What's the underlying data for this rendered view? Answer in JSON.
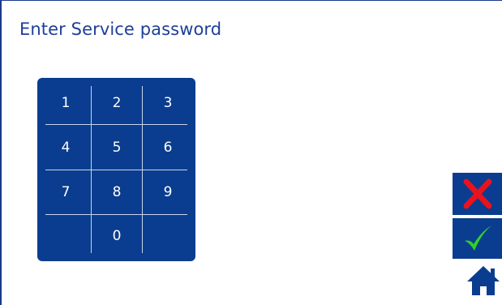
{
  "header": {
    "title": "Enter Service password"
  },
  "keypad": {
    "keys": [
      "1",
      "2",
      "3",
      "4",
      "5",
      "6",
      "7",
      "8",
      "9",
      "",
      "0",
      ""
    ]
  },
  "actions": {
    "cancel_icon": "red-x-icon",
    "confirm_icon": "green-check-icon",
    "home_icon": "home-icon"
  },
  "colors": {
    "keypad_bg": "#0a3d8f",
    "title": "#1f3f98",
    "cancel": "#e8131e",
    "confirm": "#2ed12b",
    "home": "#0a3d8f"
  }
}
